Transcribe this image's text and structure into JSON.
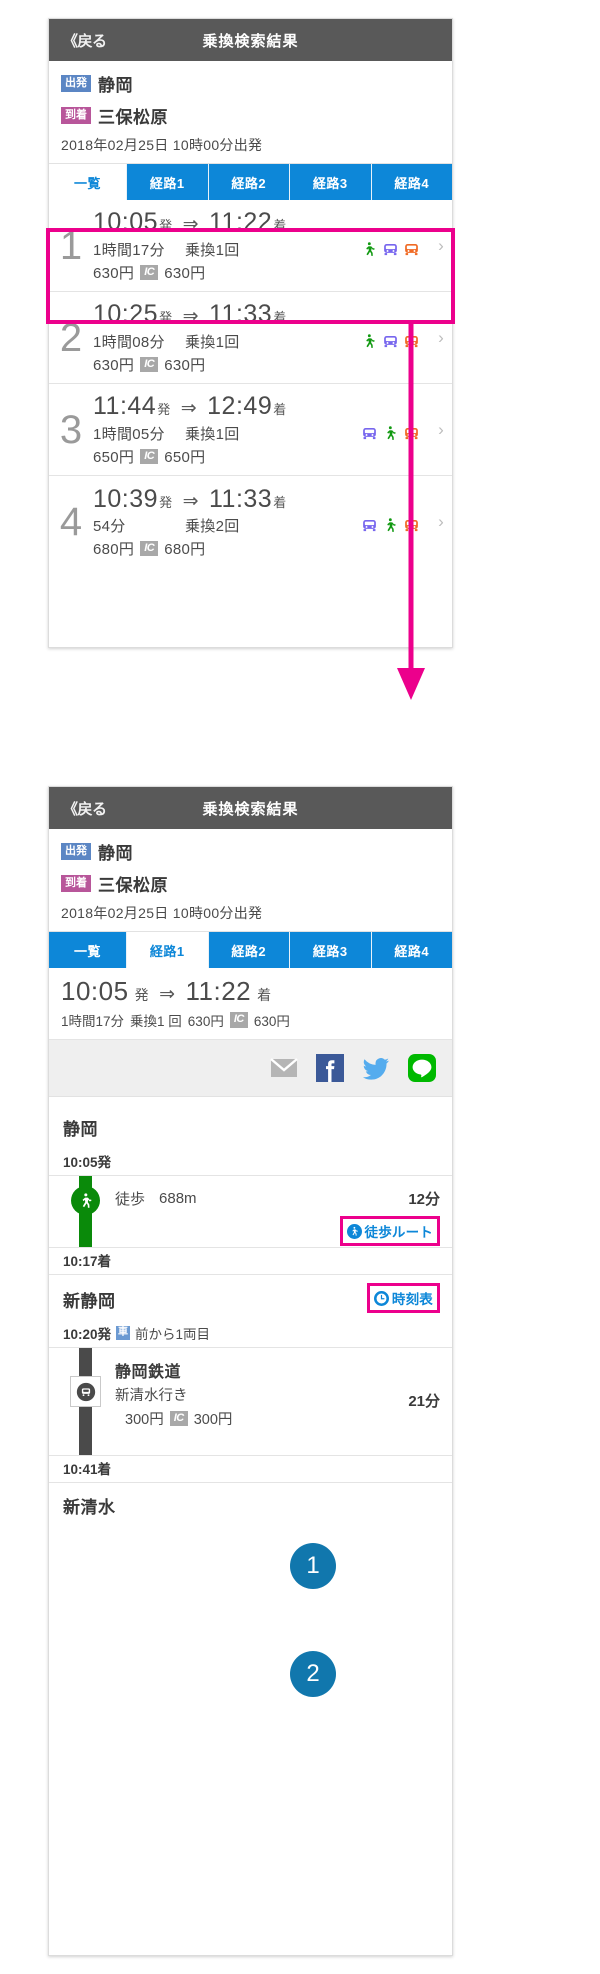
{
  "titlebar": {
    "back_label": "《戻る",
    "title": "乗換検索結果"
  },
  "search": {
    "departure_tag": "出発",
    "departure_station": "静岡",
    "arrival_tag": "到着",
    "arrival_station": "三保松原",
    "datetime": "2018年02月25日 10時00分出発"
  },
  "tabs": [
    {
      "label": "一覧"
    },
    {
      "label": "経路1"
    },
    {
      "label": "経路2"
    },
    {
      "label": "経路3"
    },
    {
      "label": "経路4"
    }
  ],
  "routes": [
    {
      "num": "1",
      "depart": "10:05",
      "depart_suffix": "発",
      "arrow": "⇒",
      "arrive": "11:22",
      "arrive_suffix": "着",
      "duration": "1時間17分",
      "transfers": "乗換1回",
      "fare": "630円",
      "ic_badge": "IC",
      "ic_fare": "630円",
      "icons": [
        "walk-icon",
        "train-icon",
        "bus-icon"
      ]
    },
    {
      "num": "2",
      "depart": "10:25",
      "depart_suffix": "発",
      "arrow": "⇒",
      "arrive": "11:33",
      "arrive_suffix": "着",
      "duration": "1時間08分",
      "transfers": "乗換1回",
      "fare": "630円",
      "ic_badge": "IC",
      "ic_fare": "630円",
      "icons": [
        "walk-icon",
        "train-icon",
        "bus-icon"
      ]
    },
    {
      "num": "3",
      "depart": "11:44",
      "depart_suffix": "発",
      "arrow": "⇒",
      "arrive": "12:49",
      "arrive_suffix": "着",
      "duration": "1時間05分",
      "transfers": "乗換1回",
      "fare": "650円",
      "ic_badge": "IC",
      "ic_fare": "650円",
      "icons": [
        "train-icon",
        "walk-icon",
        "bus-icon"
      ]
    },
    {
      "num": "4",
      "depart": "10:39",
      "depart_suffix": "発",
      "arrow": "⇒",
      "arrive": "11:33",
      "arrive_suffix": "着",
      "duration": "54分",
      "transfers": "乗換2回",
      "fare": "680円",
      "ic_badge": "IC",
      "ic_fare": "680円",
      "icons": [
        "train-icon",
        "walk-icon",
        "bus-icon"
      ]
    }
  ],
  "detail": {
    "summary": {
      "depart": "10:05",
      "depart_suffix": "発",
      "arrow": "⇒",
      "arrive": "11:22",
      "arrive_suffix": "着",
      "duration": "1時間17分",
      "transfers": "乗換1 回",
      "fare": "630円",
      "ic_badge": "IC",
      "ic_fare": "630円"
    },
    "share": [
      {
        "name": "mail-icon",
        "color": "#b5b5b5"
      },
      {
        "name": "facebook-icon",
        "color": "#3b5998"
      },
      {
        "name": "twitter-icon",
        "color": "#55acee"
      },
      {
        "name": "line-icon",
        "color": "#00b900"
      }
    ],
    "timeline": [
      {
        "station": "静岡",
        "time": "10:05発"
      },
      {
        "kind": "walk",
        "mode_label": "徒歩",
        "distance": "688m",
        "minutes": "12分",
        "chip_label": "徒歩ルート",
        "chip_icon": "walk-circle-icon",
        "callout": "1"
      },
      {
        "station_time_only": "10:17着"
      },
      {
        "station": "新静岡",
        "time": "10:20発",
        "car_badge": "車",
        "car_note": "前から1両目",
        "chip_label": "時刻表",
        "chip_icon": "clock-icon",
        "callout": "2"
      },
      {
        "kind": "train",
        "line_name": "静岡鉄道",
        "destination": "新清水行き",
        "minutes": "21分",
        "fare": "300円",
        "ic_badge": "IC",
        "ic_fare": "300円"
      },
      {
        "station_time_only": "10:41着"
      },
      {
        "station_partial": "新清水"
      }
    ]
  },
  "colors": {
    "accent_blue": "#0d87d8",
    "highlight_pink": "#ec008c",
    "titlebar_gray": "#595959",
    "walk_green": "#0a8a0a",
    "train_dark": "#4a4a4a",
    "bubble_blue": "#1177ad"
  }
}
